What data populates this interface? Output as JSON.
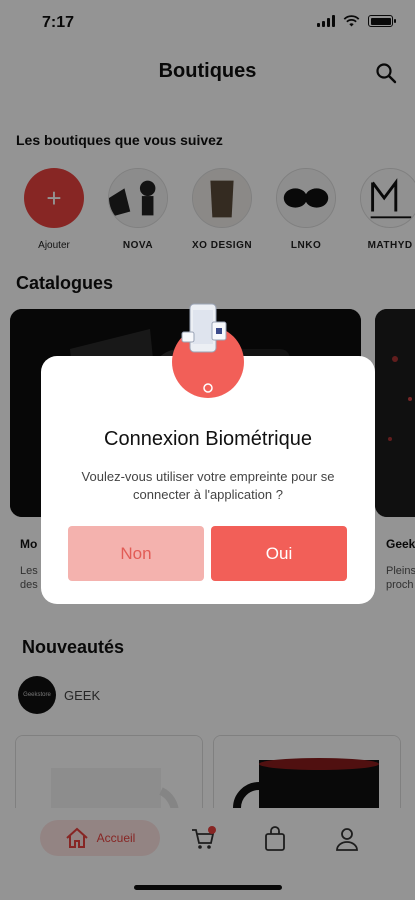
{
  "status": {
    "time": "7:17"
  },
  "header": {
    "title": "Boutiques"
  },
  "following": {
    "label": "Les boutiques que vous suivez",
    "shops": [
      {
        "name": "Ajouter"
      },
      {
        "name": "NOVA"
      },
      {
        "name": "XO DESIGN"
      },
      {
        "name": "LNKO"
      },
      {
        "name": "MATHYD"
      }
    ]
  },
  "catalogues": {
    "label": "Catalogues",
    "items": [
      {
        "title": "Mo",
        "desc1": "Les",
        "desc2": "des"
      },
      {
        "title": "Geek",
        "desc1": "Pleins",
        "desc2": "proch"
      }
    ]
  },
  "news": {
    "label": "Nouveautés",
    "shop_name": "GEEK",
    "avatar_text": "Geekstore"
  },
  "nav": {
    "home_label": "Accueil"
  },
  "dialog": {
    "title": "Connexion Biométrique",
    "message": "Voulez-vous utiliser votre empreinte pour se connecter à l'application ?",
    "no_label": "Non",
    "yes_label": "Oui"
  },
  "colors": {
    "accent": "#f25f58",
    "accent_light": "#f4b2ae",
    "brand_red": "#e8423f"
  }
}
